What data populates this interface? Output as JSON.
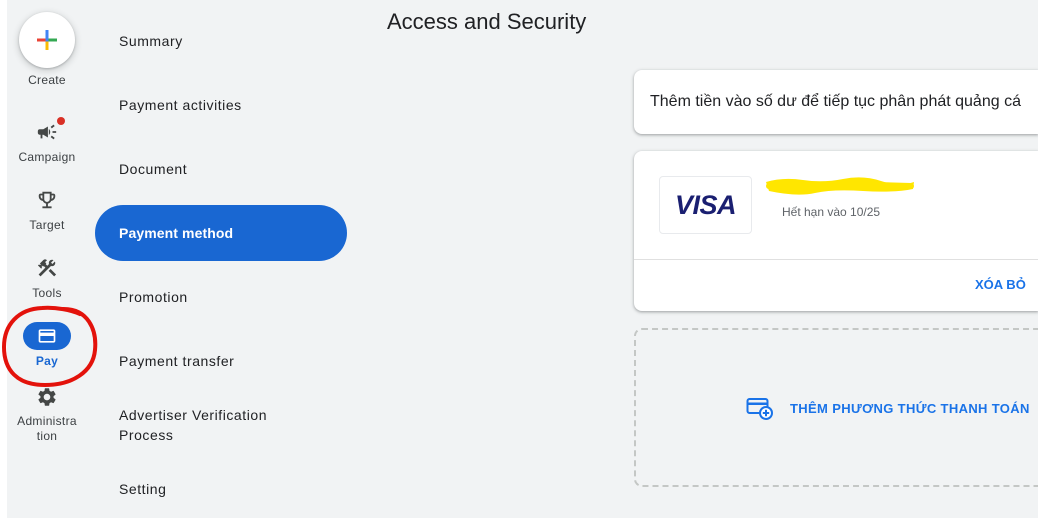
{
  "rail": {
    "create_label": "Create",
    "create_icon": "google-plus-icon",
    "items": [
      {
        "label": "Campaign",
        "icon": "campaign-icon",
        "badge": true
      },
      {
        "label": "Target",
        "icon": "trophy-icon"
      },
      {
        "label": "Tools",
        "icon": "tools-icon"
      },
      {
        "label": "Pay",
        "icon": "credit-card-icon",
        "active": true
      },
      {
        "label": "Administration",
        "icon": "gear-icon"
      }
    ]
  },
  "nav": {
    "items": [
      {
        "label": "Summary"
      },
      {
        "label": "Payment activities"
      },
      {
        "label": "Document"
      },
      {
        "label": "Payment method",
        "active": true
      },
      {
        "label": "Promotion"
      },
      {
        "label": "Payment transfer"
      },
      {
        "label": "Advertiser Verification Process"
      },
      {
        "label": "Setting"
      }
    ]
  },
  "page": {
    "title": "Access and Security"
  },
  "notice": {
    "text": "Thêm tiền vào số dư để tiếp tục phân phát quảng cá"
  },
  "payment_card": {
    "brand": "VISA",
    "expiry": "Hết hạn vào 10/25",
    "remove_label": "XÓA BỎ"
  },
  "add_payment": {
    "label": "THÊM PHƯƠNG THỨC THANH TOÁN",
    "icon": "add-card-icon"
  },
  "colors": {
    "page_bg": "#f1f3f4",
    "accent": "#1967d2",
    "link": "#1a73e8",
    "badge": "#d93025",
    "annotation": "#e3120b",
    "redaction": "#ffe600",
    "visa": "#1a1f71"
  }
}
